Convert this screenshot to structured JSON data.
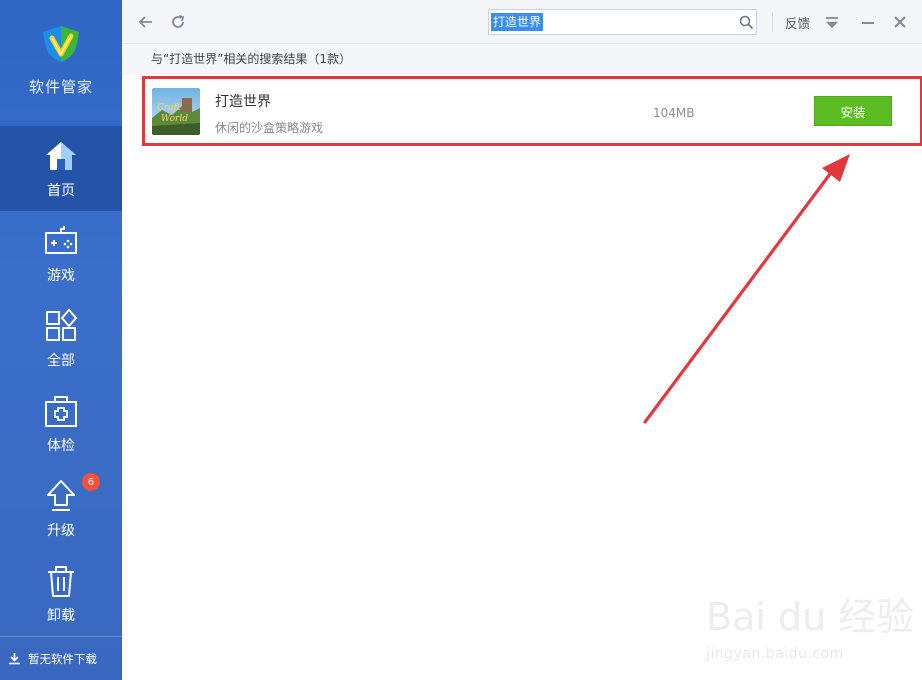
{
  "app": {
    "brand_name": "软件管家",
    "colors": {
      "sidebar": "#3a6fcb",
      "sidebar_active": "#2553a8",
      "install": "#5cbd22",
      "highlight": "#e2383d",
      "badge": "#f2513c",
      "selection": "#3b8ef0"
    }
  },
  "sidebar": {
    "items": [
      {
        "label": "首页",
        "icon": "home-icon"
      },
      {
        "label": "游戏",
        "icon": "gamepad-icon"
      },
      {
        "label": "全部",
        "icon": "apps-grid-icon"
      },
      {
        "label": "体检",
        "icon": "medical-kit-icon"
      },
      {
        "label": "升级",
        "icon": "upload-icon",
        "badge": "6"
      },
      {
        "label": "卸载",
        "icon": "trash-icon"
      }
    ],
    "download_status": "暂无软件下载"
  },
  "topbar": {
    "search_value": "打造世界",
    "feedback_label": "反馈"
  },
  "results": {
    "summary": "与“打造世界”相关的搜索结果（1款）",
    "items": [
      {
        "name": "打造世界",
        "description": "休闲的沙盒策略游戏",
        "size": "104MB",
        "install_label": "安装",
        "thumb_text_1": "Craft",
        "thumb_text_2": "World"
      }
    ]
  },
  "watermark": {
    "brand": "Bai du 经验",
    "site": "jingyan.baidu.com"
  }
}
